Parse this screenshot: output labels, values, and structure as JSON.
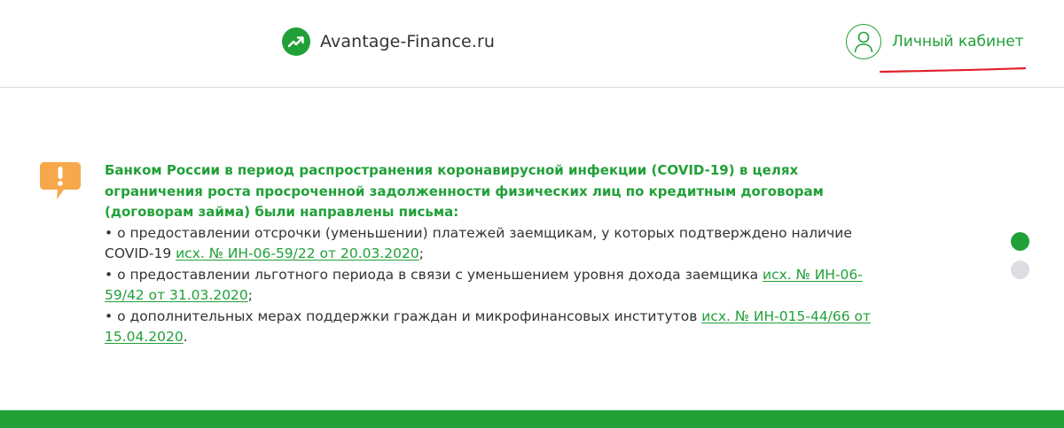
{
  "header": {
    "logo_text": "Avantage-Finance.ru",
    "account_label": "Личный кабинет"
  },
  "notice": {
    "title": "Банком России в период распространения коронавирусной инфекции (COVID-19) в целях ограничения роста просроченной задолженности физических лиц по кредитным договорам (договорам займа) были направлены письма:",
    "items": [
      {
        "text": "• о предоставлении отсрочки (уменьшении) платежей заемщикам, у которых подтверждено наличие COVID-19 ",
        "link": "исх. № ИН-06-59/22 от 20.03.2020",
        "suffix": ";"
      },
      {
        "text": "• о предоставлении льготного периода в связи с уменьшением уровня дохода заемщика ",
        "link": "исх. № ИН-06-59/42 от 31.03.2020",
        "suffix": ";"
      },
      {
        "text": "• о дополнительных мерах поддержки граждан и микрофинансовых институтов ",
        "link": "исх. № ИН-015-44/66 от 15.04.2020",
        "suffix": "."
      }
    ]
  },
  "carousel": {
    "active_index": 0,
    "count": 2
  },
  "colors": {
    "brand_green": "#21a038",
    "warning_orange": "#f7a84b",
    "underline_red": "#e0202a",
    "inactive_dot": "#dcdde3"
  },
  "icons": {
    "logo": "trend-up-arrow-icon",
    "account": "user-circle-icon",
    "notice": "warning-speech-bubble-icon"
  }
}
